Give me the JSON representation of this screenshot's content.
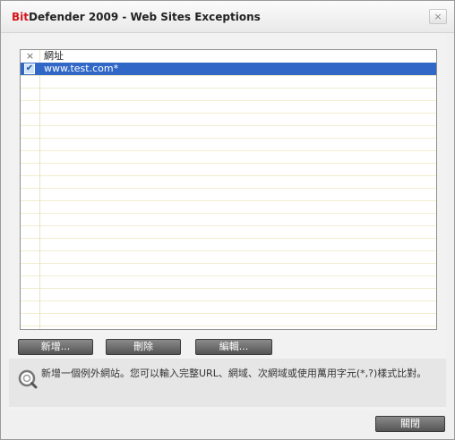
{
  "window": {
    "title_brand": "Bit",
    "title_rest": "Defender 2009 - Web Sites Exceptions",
    "close_glyph": "×"
  },
  "list": {
    "header_x": "×",
    "column_label": "網址",
    "rows": [
      {
        "checked": true,
        "check_glyph": "✔",
        "text": "www.test.com*"
      }
    ]
  },
  "buttons": {
    "add": "新增...",
    "delete": "刪除",
    "edit": "編輯...",
    "close": "關閉"
  },
  "info": {
    "text": "新增一個例外網站。您可以輸入完整URL、網域、次網域或使用萬用字元(*,?)樣式比對。",
    "icon": "search-help-icon"
  },
  "colors": {
    "brand": "#d4161c",
    "selection": "#3168c7",
    "button": "#6e6e6e"
  }
}
